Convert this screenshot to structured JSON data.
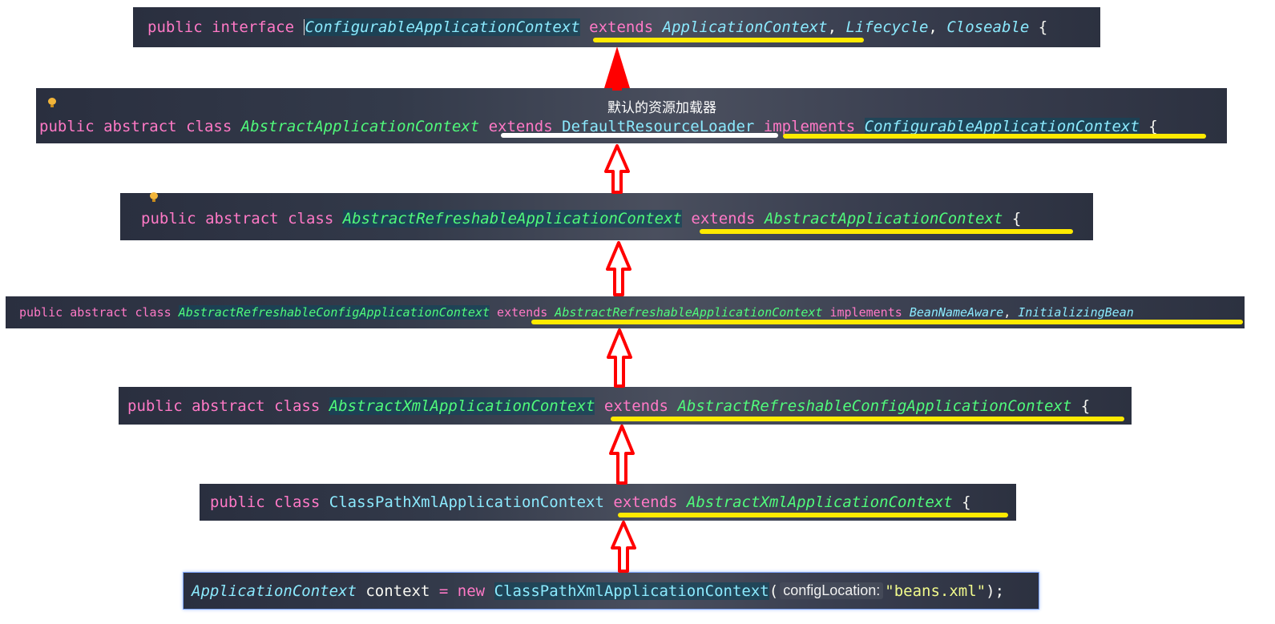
{
  "rows": [
    {
      "id": "configurable-app-context",
      "tokens": {
        "kw1": "public",
        "kw2": "interface",
        "name": "ConfigurableApplicationContext",
        "ext": "extends",
        "parent": "ApplicationContext",
        "sep1": ",",
        "i1": "Lifecycle",
        "sep2": ",",
        "i2": "Closeable",
        "brace": "{"
      }
    },
    {
      "id": "abstract-app-context",
      "annotation": "默认的资源加载器",
      "tokens": {
        "kw1": "public",
        "kw2": "abstract",
        "kw3": "class",
        "name": "AbstractApplicationContext",
        "ext": "extends",
        "parent": "DefaultResourceLoader",
        "impl": "implements",
        "iface": "ConfigurableApplicationContext",
        "brace": "{"
      }
    },
    {
      "id": "abstract-refreshable-app-context",
      "tokens": {
        "kw1": "public",
        "kw2": "abstract",
        "kw3": "class",
        "name": "AbstractRefreshableApplicationContext",
        "ext": "extends",
        "parent": "AbstractApplicationContext",
        "brace": "{"
      }
    },
    {
      "id": "abstract-refreshable-config-app-context",
      "tokens": {
        "kw1": "public",
        "kw2": "abstract",
        "kw3": "class",
        "name": "AbstractRefreshableConfigApplicationContext",
        "ext": "extends",
        "parent": "AbstractRefreshableApplicationContext",
        "impl": "implements",
        "i1": "BeanNameAware",
        "sep1": ",",
        "i2": "InitializingBean"
      }
    },
    {
      "id": "abstract-xml-app-context",
      "tokens": {
        "kw1": "public",
        "kw2": "abstract",
        "kw3": "class",
        "name": "AbstractXmlApplicationContext",
        "ext": "extends",
        "parent": "AbstractRefreshableConfigApplicationContext",
        "brace": "{"
      }
    },
    {
      "id": "classpath-xml-app-context",
      "tokens": {
        "kw1": "public",
        "kw2": "class",
        "name": "ClassPathXmlApplicationContext",
        "ext": "extends",
        "parent": "AbstractXmlApplicationContext",
        "brace": "{"
      }
    },
    {
      "id": "usage",
      "tokens": {
        "type": "ApplicationContext",
        "var": "context",
        "eq": "=",
        "new": "new",
        "ctor": "ClassPathXmlApplicationContext",
        "open": "(",
        "hint": "configLocation:",
        "arg": "\"beans.xml\"",
        "close": ");"
      }
    }
  ],
  "colors": {
    "keyword": "#ff79c6",
    "class_green": "#50fa7b",
    "class_cyan": "#8be9fd",
    "string": "#f1fa8c",
    "underline_yellow": "#ffea00",
    "underline_white": "#ffffff",
    "arrow": "#ff0000"
  }
}
